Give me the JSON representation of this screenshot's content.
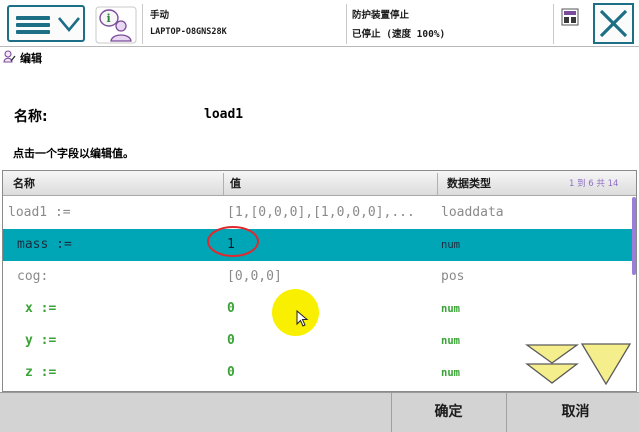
{
  "topbar": {
    "operating_mode": "手动",
    "controller_name": "LAPTOP-O8GNS28K",
    "safety_status": "防护装置停止",
    "run_status": "已停止 (速度 100%)"
  },
  "subheader": {
    "title": "编辑"
  },
  "editor": {
    "name_label": "名称:",
    "name_value": "load1",
    "instruction": "点击一个字段以编辑值。"
  },
  "table": {
    "headers": {
      "name": "名称",
      "value": "值",
      "type": "数据类型"
    },
    "pager": "1 到 6 共 14",
    "rows": [
      {
        "name": "load1 :=",
        "value": "[1,[0,0,0],[1,0,0,0],...",
        "type": "loaddata",
        "selected": false,
        "editable": false
      },
      {
        "name": "mass :=",
        "value": "1",
        "type": "num",
        "selected": true,
        "editable": true
      },
      {
        "name": "cog:",
        "value": "[0,0,0]",
        "type": "pos",
        "selected": false,
        "editable": false
      },
      {
        "name": "x :=",
        "value": "0",
        "type": "num",
        "selected": false,
        "editable": true
      },
      {
        "name": "y :=",
        "value": "0",
        "type": "num",
        "selected": false,
        "editable": true
      },
      {
        "name": "z :=",
        "value": "0",
        "type": "num",
        "selected": false,
        "editable": true
      }
    ]
  },
  "footer": {
    "ok_label": "确定",
    "cancel_label": "取消"
  },
  "colors": {
    "accent": "#1d6f86",
    "selected_row": "#00a6b5",
    "editable_text": "#3aa335",
    "readonly_text": "#8a8a8a",
    "highlight": "#e0282e",
    "click_marker": "#f8f000",
    "scroll_arrows": "#f4ee8c"
  },
  "icons": [
    "menu-icon",
    "chevron-down-icon",
    "user-info-icon",
    "system-status-icon",
    "close-icon",
    "edit-icon",
    "cursor-icon",
    "scroll-down-icon",
    "scroll-to-bottom-icon"
  ]
}
